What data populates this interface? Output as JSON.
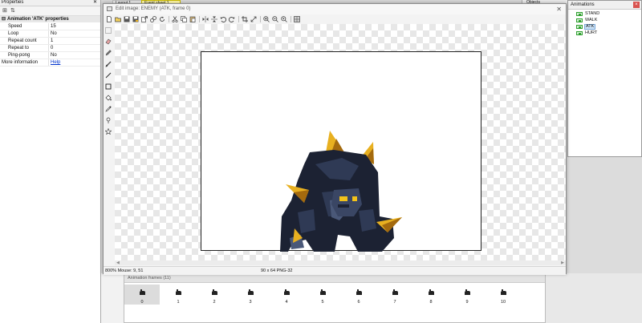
{
  "properties_panel": {
    "title": "Properties",
    "section_title": "Animation 'ATK' properties",
    "rows": [
      {
        "key": "Speed",
        "value": "15"
      },
      {
        "key": "Loop",
        "value": "No"
      },
      {
        "key": "Repeat count",
        "value": "1"
      },
      {
        "key": "Repeat to",
        "value": "0"
      },
      {
        "key": "Ping-pong",
        "value": "No"
      },
      {
        "key": "More information",
        "value": "Help"
      }
    ]
  },
  "background_tabs": {
    "tab1": "Layout 1",
    "tab2": "Event sheet 1",
    "objects_label": "Objects"
  },
  "dialog": {
    "title": "Edit image: ENEMY (ATK, frame 0)",
    "status_zoom_mouse": "800% Mouse: 9, 51",
    "status_dimensions": "90 x 64  PNG-32"
  },
  "animations_panel": {
    "title": "Animations",
    "close_glyph": "×",
    "items": [
      "STAND",
      "WALK",
      "ATK",
      "HURT"
    ],
    "selected": "ATK"
  },
  "frames_panel": {
    "title": "Animation frames (11)",
    "frames": [
      "0",
      "1",
      "2",
      "3",
      "4",
      "5",
      "6",
      "7",
      "8",
      "9",
      "10"
    ],
    "selected_index": 0
  },
  "colors": {
    "armor_dark": "#1c2233",
    "armor_mid": "#2f3a55",
    "armor_light": "#4a5878",
    "spike_gold": "#e8b020",
    "spike_shadow": "#a46a0e",
    "eye": "#f2c21a"
  }
}
